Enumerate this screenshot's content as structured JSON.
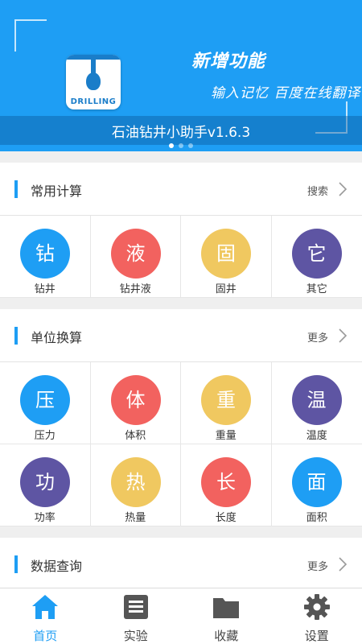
{
  "banner": {
    "logo_text": "DRILLING",
    "headline": "新增功能",
    "subline": "输入记忆 百度在线翻译",
    "app_title": "石油钻井小助手v1.6.3",
    "slides": 3,
    "active_slide": 1
  },
  "colors": {
    "blue": "#1e9ef4",
    "red": "#f2625f",
    "yellow": "#f0c860",
    "purple": "#5e55a3",
    "bg": "#efefef"
  },
  "sections": {
    "common": {
      "title": "常用计算",
      "more": "搜索",
      "items": [
        {
          "glyph": "钻",
          "label": "钻井",
          "color": "#1e9ef4"
        },
        {
          "glyph": "液",
          "label": "钻井液",
          "color": "#f2625f"
        },
        {
          "glyph": "固",
          "label": "固井",
          "color": "#f0c860"
        },
        {
          "glyph": "它",
          "label": "其它",
          "color": "#5e55a3"
        }
      ]
    },
    "units": {
      "title": "单位换算",
      "more": "更多",
      "items": [
        {
          "glyph": "压",
          "label": "压力",
          "color": "#1e9ef4"
        },
        {
          "glyph": "体",
          "label": "体积",
          "color": "#f2625f"
        },
        {
          "glyph": "重",
          "label": "重量",
          "color": "#f0c860"
        },
        {
          "glyph": "温",
          "label": "温度",
          "color": "#5e55a3"
        },
        {
          "glyph": "功",
          "label": "功率",
          "color": "#5e55a3"
        },
        {
          "glyph": "热",
          "label": "热量",
          "color": "#f0c860"
        },
        {
          "glyph": "长",
          "label": "长度",
          "color": "#f2625f"
        },
        {
          "glyph": "面",
          "label": "面积",
          "color": "#1e9ef4"
        }
      ]
    },
    "query": {
      "title": "数据查询",
      "more": "更多"
    }
  },
  "tabbar": {
    "tabs": [
      {
        "label": "首页",
        "icon": "home-icon",
        "active": true
      },
      {
        "label": "实验",
        "icon": "list-icon",
        "active": false
      },
      {
        "label": "收藏",
        "icon": "folder-icon",
        "active": false
      },
      {
        "label": "设置",
        "icon": "gear-icon",
        "active": false
      }
    ]
  }
}
